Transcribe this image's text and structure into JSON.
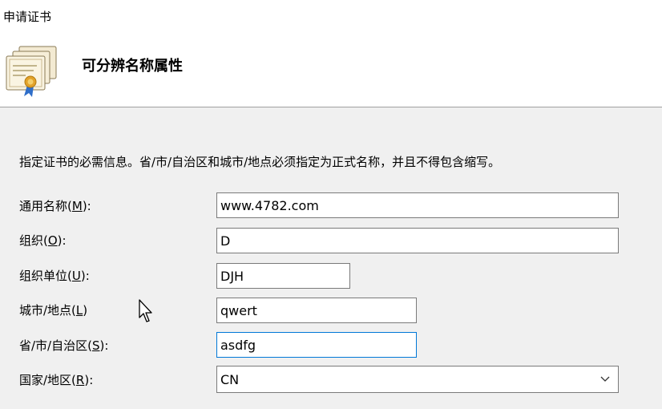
{
  "window": {
    "title": "申请证书"
  },
  "header": {
    "icon": "certificate-icon",
    "title": "可分辨名称属性"
  },
  "instruction": "指定证书的必需信息。省/市/自治区和城市/地点必须指定为正式名称，并且不得包含缩写。",
  "fields": [
    {
      "label_prefix": "通用名称(",
      "mnemonic": "M",
      "label_suffix": "):",
      "value": "www.4782.com"
    },
    {
      "label_prefix": "组织(",
      "mnemonic": "O",
      "label_suffix": "):",
      "value": "D"
    },
    {
      "label_prefix": "组织单位(",
      "mnemonic": "U",
      "label_suffix": "):",
      "value": "DJH"
    },
    {
      "label_prefix": "城市/地点(",
      "mnemonic": "L",
      "label_suffix": ")",
      "value": "qwert"
    },
    {
      "label_prefix": "省/市/自治区(",
      "mnemonic": "S",
      "label_suffix": "):",
      "value": "asdfg"
    }
  ],
  "country": {
    "label_prefix": "国家/地区(",
    "mnemonic": "R",
    "label_suffix": "):",
    "value": "CN",
    "icon": "chevron-down-icon"
  },
  "colors": {
    "focus_border": "#0078d7",
    "field_border": "#7a7a7a",
    "background": "#f0f0f0"
  }
}
